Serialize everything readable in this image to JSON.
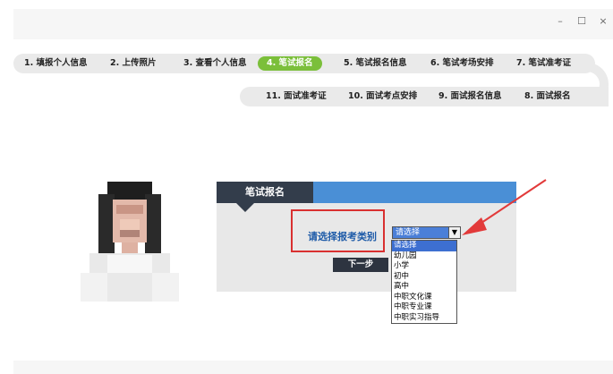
{
  "window": {
    "minimize": "–",
    "maximize": "☐",
    "close": "×"
  },
  "steps_row1": [
    {
      "label": "1. 填报个人信息",
      "active": false
    },
    {
      "label": "2. 上传照片",
      "active": false
    },
    {
      "label": "3. 查看个人信息",
      "active": false
    },
    {
      "label": "4. 笔试报名",
      "active": true
    },
    {
      "label": "5. 笔试报名信息",
      "active": false
    },
    {
      "label": "6. 笔试考场安排",
      "active": false
    },
    {
      "label": "7. 笔试准考证",
      "active": false
    }
  ],
  "steps_row2": [
    {
      "label": "11. 面试准考证"
    },
    {
      "label": "10. 面试考点安排"
    },
    {
      "label": "9. 面试报名信息"
    },
    {
      "label": "8. 面试报名"
    }
  ],
  "panel": {
    "tab_title": "笔试报名",
    "select_label": "请选择报考类别",
    "select_value": "请选择",
    "options": [
      "请选择",
      "幼儿园",
      "小学",
      "初中",
      "高中",
      "中职文化课",
      "中职专业课",
      "中职实习指导"
    ],
    "selected_index": 0,
    "next_button": "下一步"
  },
  "colors": {
    "active_step": "#7bbf3a",
    "panel_header": "#4a8fd6",
    "panel_tab": "#333d4b",
    "callout": "#d93030"
  }
}
